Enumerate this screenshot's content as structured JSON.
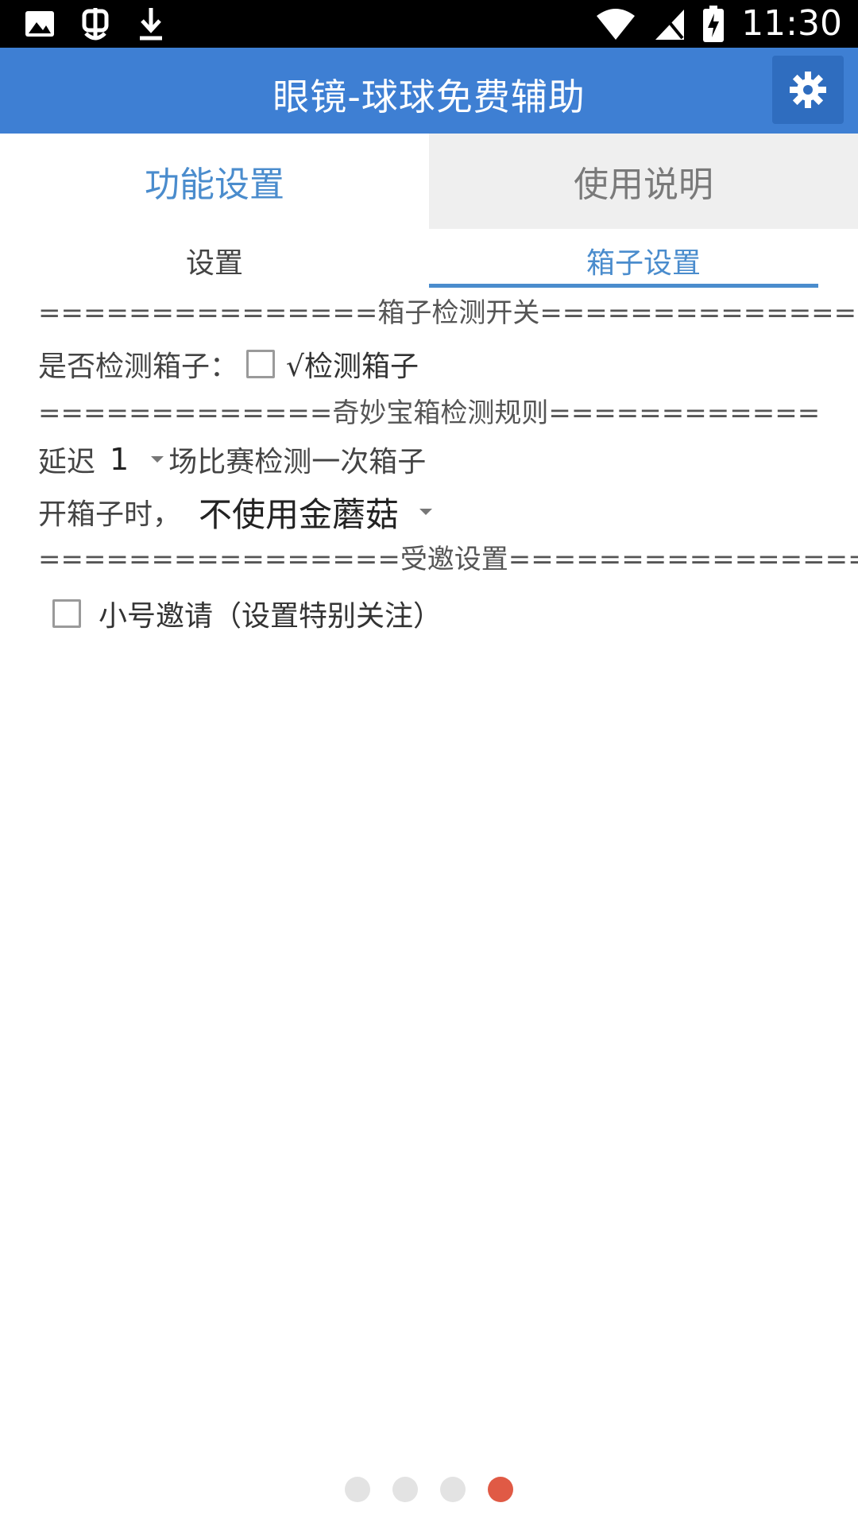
{
  "status_bar": {
    "time": "11:30",
    "icons": [
      "image-icon",
      "bug-icon",
      "download-icon",
      "wifi-icon",
      "signal-icon",
      "battery-charging-icon"
    ]
  },
  "app_bar": {
    "title": "眼镜-球球免费辅助",
    "settings_icon": "gear-icon"
  },
  "main_tabs": [
    {
      "label": "功能设置",
      "active": true
    },
    {
      "label": "使用说明",
      "active": false
    }
  ],
  "sub_tabs": [
    {
      "label": "设置",
      "active": false
    },
    {
      "label": "箱子设置",
      "active": true
    }
  ],
  "sections": {
    "box_switch_header": "===============箱子检测开关===============",
    "detect_label": "是否检测箱子：",
    "detect_checkbox_label": "√检测箱子",
    "chest_rule_header": "=============奇妙宝箱检测规则============",
    "delay_prefix": "延迟",
    "delay_value": "1",
    "delay_suffix": "场比赛检测一次箱子",
    "open_prefix": "开箱子时，",
    "open_value": "不使用金蘑菇",
    "invite_header": "================受邀设置=================",
    "invite_checkbox_label": "小号邀请（设置特别关注）"
  },
  "page_indicator": {
    "count": 4,
    "active_index": 3
  },
  "colors": {
    "app_bar": "#3e7fd3",
    "accent": "#4a8ccd",
    "active_dot": "#e05a45"
  }
}
